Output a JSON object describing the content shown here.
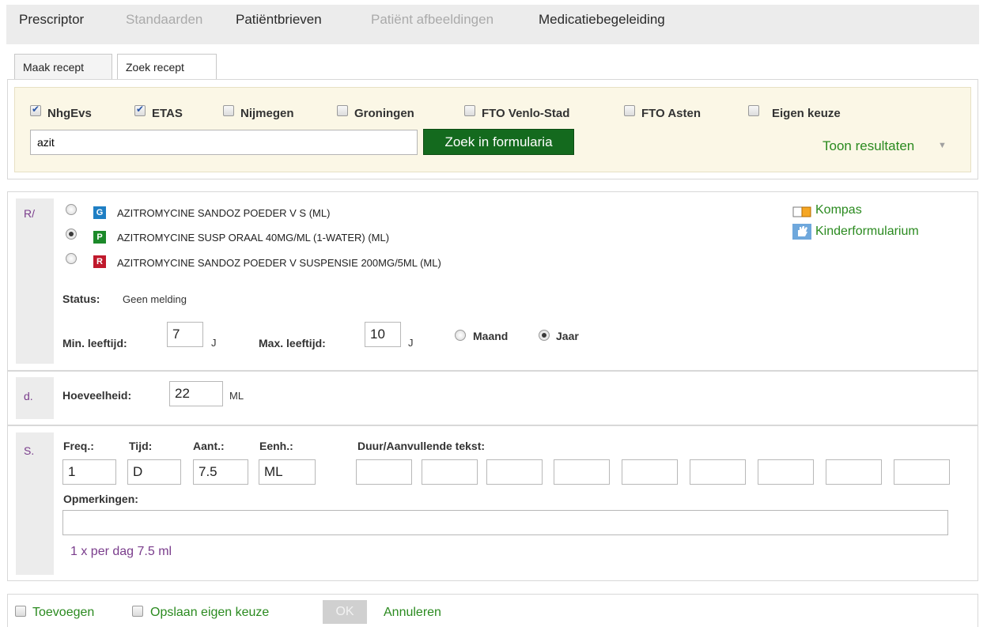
{
  "nav": {
    "items": [
      {
        "label": "Prescriptor",
        "state": "active"
      },
      {
        "label": "Standaarden",
        "state": "disabled"
      },
      {
        "label": "Patiëntbrieven",
        "state": "active"
      },
      {
        "label": "Patiënt afbeeldingen",
        "state": "disabled"
      },
      {
        "label": "Medicatiebegeleiding",
        "state": "active"
      }
    ]
  },
  "tabs": [
    {
      "label": "Maak recept",
      "selected": false
    },
    {
      "label": "Zoek recept",
      "selected": true
    }
  ],
  "formularia": {
    "sources": [
      {
        "label": "NhgEvs",
        "checked": true
      },
      {
        "label": "ETAS",
        "checked": true
      },
      {
        "label": "Nijmegen",
        "checked": false
      },
      {
        "label": "Groningen",
        "checked": false
      },
      {
        "label": "FTO Venlo-Stad",
        "checked": false
      },
      {
        "label": "FTO Asten",
        "checked": false
      },
      {
        "label": "Eigen keuze",
        "checked": false
      }
    ],
    "search_value": "azit",
    "search_button": "Zoek in formularia",
    "toon_resultaten": "Toon resultaten",
    "toon_caret": "▼"
  },
  "recipe": {
    "label": "R/",
    "options": [
      {
        "badge": "G",
        "badge_color": "#1f7fc4",
        "name": "AZITROMYCINE SANDOZ POEDER V S (ML)",
        "selected": false
      },
      {
        "badge": "P",
        "badge_color": "#1c8a2a",
        "name": "AZITROMYCINE SUSP ORAAL 40MG/ML (1-WATER) (ML)",
        "selected": true
      },
      {
        "badge": "R",
        "badge_color": "#c0192c",
        "name": "AZITROMYCINE SANDOZ POEDER V SUSPENSIE 200MG/5ML (ML)",
        "selected": false
      }
    ],
    "links": {
      "kompas": "Kompas",
      "kinderformularium": "Kinderformularium"
    },
    "status_label": "Status:",
    "status_value": "Geen melding",
    "min_age_label": "Min. leeftijd:",
    "min_age_value": "7",
    "min_age_unit": "J",
    "max_age_label": "Max. leeftijd:",
    "max_age_value": "10",
    "max_age_unit": "J",
    "age_unit_options": [
      {
        "label": "Maand",
        "selected": false
      },
      {
        "label": "Jaar",
        "selected": true
      }
    ]
  },
  "dose": {
    "label": "d.",
    "quantity_label": "Hoeveelheid:",
    "quantity_value": "22",
    "quantity_unit": "ML"
  },
  "signatura": {
    "label": "S.",
    "freq_label": "Freq.:",
    "freq_value": "1",
    "tijd_label": "Tijd:",
    "tijd_value": "D",
    "aant_label": "Aant.:",
    "aant_value": "7.5",
    "eenh_label": "Eenh.:",
    "eenh_value": "ML",
    "duur_label": "Duur/Aanvullende tekst:",
    "duur_fields": [
      "",
      "",
      "",
      "",
      "",
      "",
      "",
      "",
      ""
    ],
    "opmerkingen_label": "Opmerkingen:",
    "opmerkingen_value": "",
    "summary": "1 x per dag 7.5 ml"
  },
  "footer": {
    "toevoegen": "Toevoegen",
    "opslaan": "Opslaan eigen keuze",
    "ok": "OK",
    "annuleren": "Annuleren"
  }
}
